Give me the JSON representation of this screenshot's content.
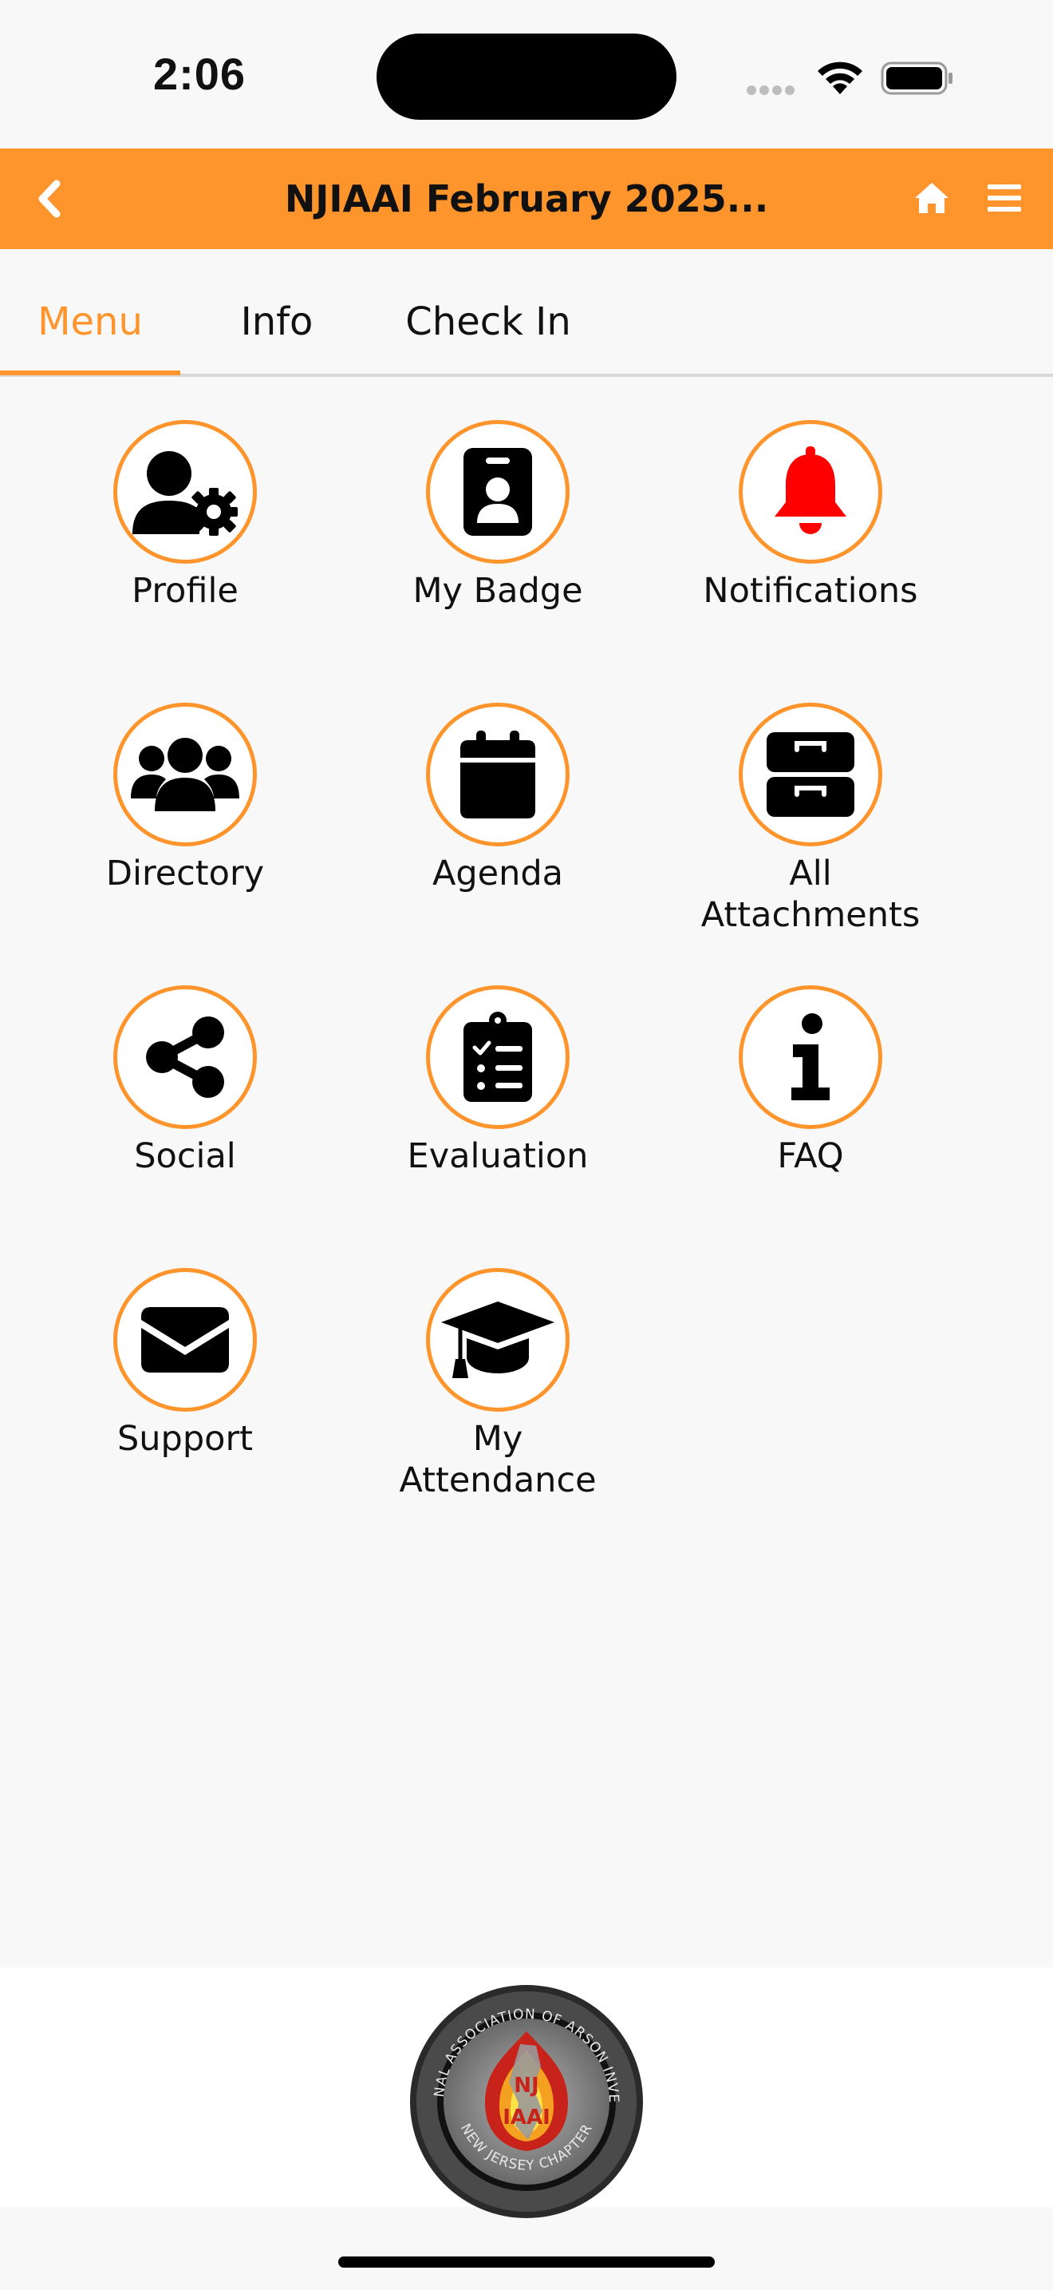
{
  "status_bar": {
    "time": "2:06"
  },
  "header": {
    "title": "NJIAAI February 2025..."
  },
  "tabs": [
    {
      "label": "Menu",
      "active": true
    },
    {
      "label": "Info",
      "active": false
    },
    {
      "label": "Check In",
      "active": false
    }
  ],
  "menu": {
    "items": [
      {
        "label": "Profile",
        "icon": "user-gear-icon"
      },
      {
        "label": "My Badge",
        "icon": "id-badge-icon"
      },
      {
        "label": "Notifications",
        "icon": "bell-icon"
      },
      {
        "label": "Directory",
        "icon": "users-icon"
      },
      {
        "label": "Agenda",
        "icon": "calendar-icon"
      },
      {
        "label": "All Attachments",
        "icon": "file-cabinet-icon"
      },
      {
        "label": "Social",
        "icon": "share-icon"
      },
      {
        "label": "Evaluation",
        "icon": "clipboard-list-icon"
      },
      {
        "label": "FAQ",
        "icon": "info-icon"
      },
      {
        "label": "Support",
        "icon": "envelope-icon"
      },
      {
        "label": "My Attendance",
        "icon": "graduation-cap-icon"
      }
    ]
  },
  "footer": {
    "logo_text": "INTERNATIONAL ASSOCIATION OF ARSON INVESTIGATORS · NEW JERSEY CHAPTER · NJ · IAAI"
  },
  "colors": {
    "accent": "#fd952c",
    "notification": "#ff0000",
    "background": "#f8f8f8"
  }
}
